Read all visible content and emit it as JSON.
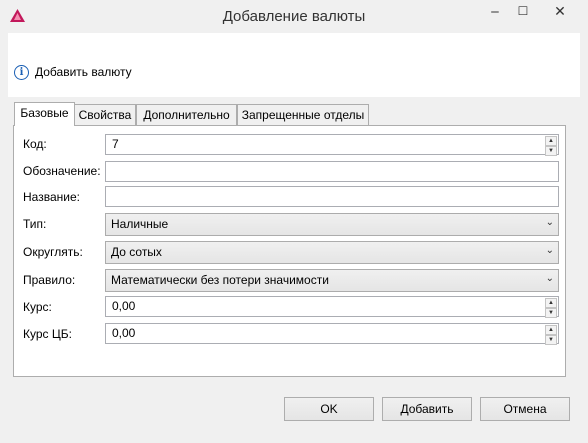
{
  "window": {
    "title": "Добавление валюты"
  },
  "banner": {
    "text": "Добавить валюту"
  },
  "tabs": [
    {
      "label": "Базовые",
      "active": true
    },
    {
      "label": "Свойства",
      "active": false
    },
    {
      "label": "Дополнительно",
      "active": false
    },
    {
      "label": "Запрещенные отделы",
      "active": false
    }
  ],
  "form": {
    "code": {
      "label": "Код:",
      "value": "7"
    },
    "designation": {
      "label": "Обозначение:",
      "value": ""
    },
    "name": {
      "label": "Название:",
      "value": ""
    },
    "type": {
      "label": "Тип:",
      "value": "Наличные"
    },
    "rounding": {
      "label": "Округлять:",
      "value": "До сотых"
    },
    "rule": {
      "label": "Правило:",
      "value": "Математически без потери значимости"
    },
    "rate": {
      "label": "Курс:",
      "value": "0,00"
    },
    "cb_rate": {
      "label": "Курс ЦБ:",
      "value": "0,00"
    }
  },
  "buttons": {
    "ok": "OK",
    "add": "Добавить",
    "cancel": "Отмена"
  },
  "colors": {
    "accent": "#1a5fb4",
    "app_icon": "#c2185b"
  }
}
